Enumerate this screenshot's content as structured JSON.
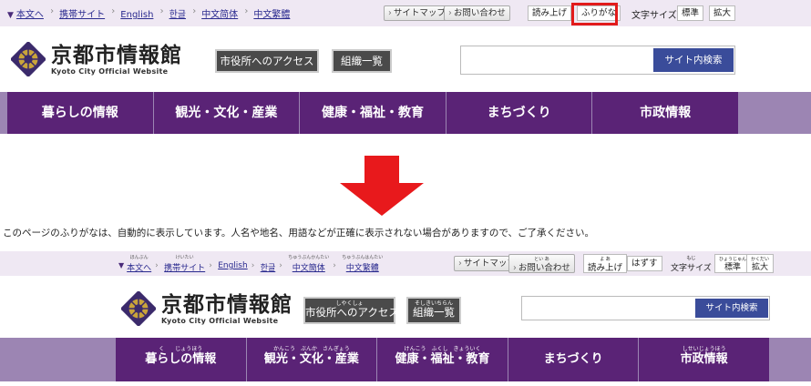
{
  "before": {
    "utility_links": [
      "本文へ",
      "携帯サイト",
      "English",
      "한글",
      "中文简体",
      "中文繁體"
    ],
    "sitemap_label": "サイトマップ",
    "contact_label": "お問い合わせ",
    "read_aloud_label": "読み上げ",
    "furigana_label": "ふりがな",
    "text_size_label": "文字サイズ",
    "size_standard_label": "標準",
    "size_large_label": "拡大",
    "logo_title": "京都市情報館",
    "logo_subtitle": "Kyoto City Official Website",
    "access_button": "市役所へのアクセス",
    "org_button": "組織一覧",
    "search_placeholder": "",
    "search_button": "サイト内検索",
    "nav": [
      "暮らしの情報",
      "観光・文化・産業",
      "健康・福祉・教育",
      "まちづくり",
      "市政情報"
    ]
  },
  "notice": "このページのふりがなは、自動的に表示しています。人名や地名、用語などが正確に表示されない場合がありますので、ご了承ください。",
  "after": {
    "utility_links": [
      {
        "rt": "ほんぶん",
        "label": "本文へ"
      },
      {
        "rt": "けいたい",
        "label": "携帯サイト"
      },
      {
        "rt": "",
        "label": "English"
      },
      {
        "rt": "",
        "label": "한글"
      },
      {
        "rt": "ちゅうぶんかんたい",
        "label": "中文簡体"
      },
      {
        "rt": "ちゅうぶんはんたい",
        "label": "中文繁體"
      }
    ],
    "sitemap_label": "サイトマップ",
    "contact_label": "お問い合わせ",
    "contact_rt": "とい あ",
    "read_aloud_label": "読み上げ",
    "read_aloud_rt": "よ あ",
    "hiragana_off_label": "はずす",
    "text_size_label": "文字サイズ",
    "text_size_rt": "もじ",
    "size_standard_label": "標準",
    "size_standard_rt": "ひょうじゅん",
    "size_large_label": "拡大",
    "size_large_rt": "かくだい",
    "logo_title": "京都市情報館",
    "logo_subtitle": "Kyoto City Official Website",
    "access_button": "市役所へのアクセス",
    "access_rt": "しやくしょ",
    "org_button": "組織一覧",
    "org_rt": "そしきいちらん",
    "search_button": "サイト内検索",
    "nav": [
      {
        "rt": "く　　じょうほう",
        "label": "暮らしの情報"
      },
      {
        "rt": "かんこう　ぶんか　さんぎょう",
        "label": "観光・文化・産業"
      },
      {
        "rt": "けんこう　ふくし　きょういく",
        "label": "健康・福祉・教育"
      },
      {
        "rt": "",
        "label": "まちづくり"
      },
      {
        "rt": "しせいじょうほう",
        "label": "市政情報"
      }
    ]
  },
  "colors": {
    "nav_purple": "#5a2376",
    "nav_light": "#9c85b3",
    "search_blue": "#3a4c9a",
    "highlight_red": "#e21b1b",
    "arrow_red": "#e8191c"
  }
}
